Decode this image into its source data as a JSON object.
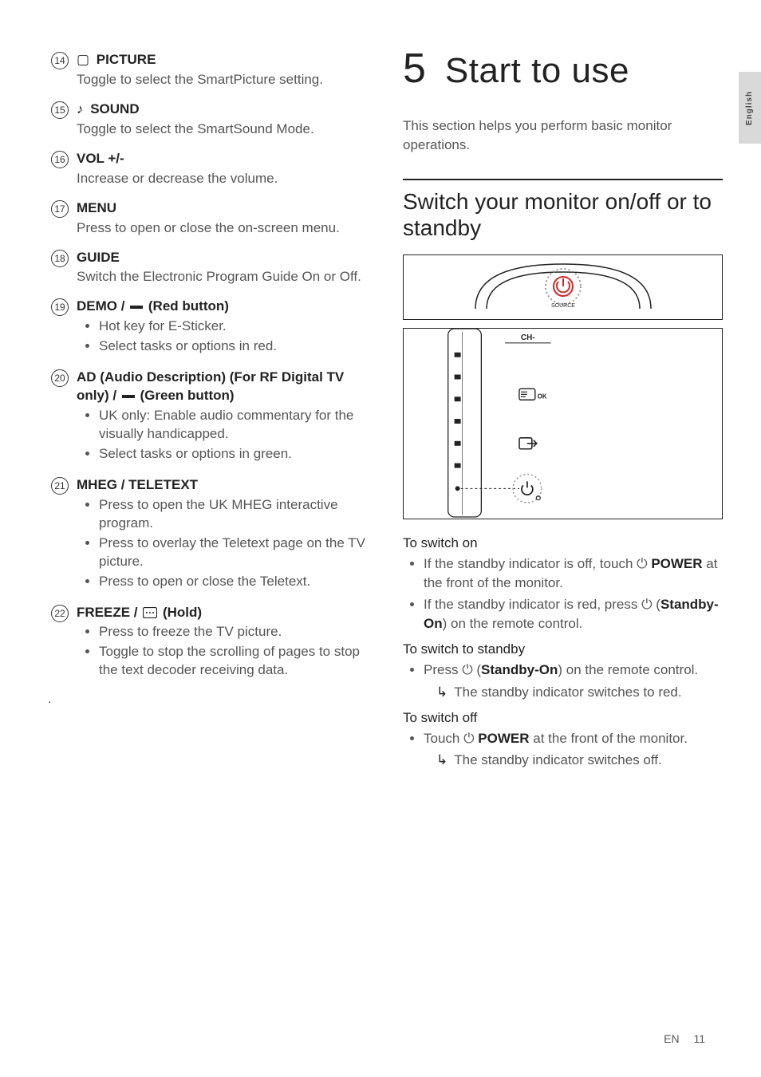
{
  "side_tab": "English",
  "footer": {
    "lang": "EN",
    "page": "11"
  },
  "items": [
    {
      "num": "14",
      "icon": "▢",
      "title": "PICTURE",
      "desc": "Toggle to select the SmartPicture setting.",
      "bullets": []
    },
    {
      "num": "15",
      "icon": "♪",
      "title": "SOUND",
      "desc": "Toggle to select the SmartSound Mode.",
      "bullets": []
    },
    {
      "num": "16",
      "icon": "",
      "title": "VOL +/-",
      "desc": "Increase or decrease the volume.",
      "bullets": []
    },
    {
      "num": "17",
      "icon": "",
      "title": "MENU",
      "desc": "Press to open or close the on-screen menu.",
      "bullets": []
    },
    {
      "num": "18",
      "icon": "",
      "title": "GUIDE",
      "desc": "Switch the Electronic Program   Guide On or Off.",
      "bullets": []
    },
    {
      "num": "19",
      "icon": "",
      "title_html": "DEMO / <span class='dash'></span> (Red button)",
      "bullets": [
        "Hot key for E-Sticker.",
        "Select tasks or options in red."
      ]
    },
    {
      "num": "20",
      "icon": "",
      "title_html": "AD (Audio Description) (For RF Digital TV only) / <span class='dash'></span> (Green button)",
      "bullets": [
        "UK only: Enable audio commentary for the visually handicapped.",
        "Select tasks or options in green."
      ]
    },
    {
      "num": "21",
      "icon": "",
      "title": "MHEG / TELETEXT",
      "bullets": [
        "Press to open the UK MHEG interactive program.",
        "Press to overlay the Teletext page on the TV picture.",
        "Press to open or close the Teletext."
      ]
    },
    {
      "num": "22",
      "icon": "",
      "title_html": "FREEZE / <svg class='hold-icon' width='18' height='14' viewBox='0 0 18 14'><rect x='0.5' y='0.5' width='17' height='13' rx='2' fill='none' stroke='#222' stroke-width='1.2'/><circle cx='5' cy='7' r='1' fill='#222'/><circle cx='9' cy='7' r='1' fill='#222'/><circle cx='13' cy='7' r='1' fill='#222'/></svg> (Hold)",
      "bullets": [
        "Press to freeze the TV picture.",
        "Toggle to stop the scrolling of pages to stop the text decoder receiving data."
      ]
    }
  ],
  "chapter": {
    "num": "5",
    "title": "Start to use"
  },
  "intro": "This section helps you perform basic monitor operations.",
  "section_title": "Switch your monitor on/off or to standby",
  "diagram_labels": {
    "ch_minus": "CH-",
    "ok": "OK",
    "source_label": "SOURCE"
  },
  "switch_on": {
    "head": "To switch on",
    "b1_pre": "If the standby indicator is off, touch ",
    "b1_post": " POWER",
    "b1_tail": " at the front of the monitor.",
    "b2_pre": "If the standby indicator is red, press ",
    "b2_post": " (Standby-On)",
    "b2_tail": " on the remote control."
  },
  "switch_standby": {
    "head": "To switch to standby",
    "b1_pre": "Press ",
    "b1_post": " (Standby-On)",
    "b1_tail": " on the remote control.",
    "sub": "The standby indicator switches to red."
  },
  "switch_off": {
    "head": "To switch off",
    "b1_pre": "Touch ",
    "b1_post": " POWER",
    "b1_tail": " at the front of the monitor.",
    "sub": "The standby indicator switches off."
  }
}
